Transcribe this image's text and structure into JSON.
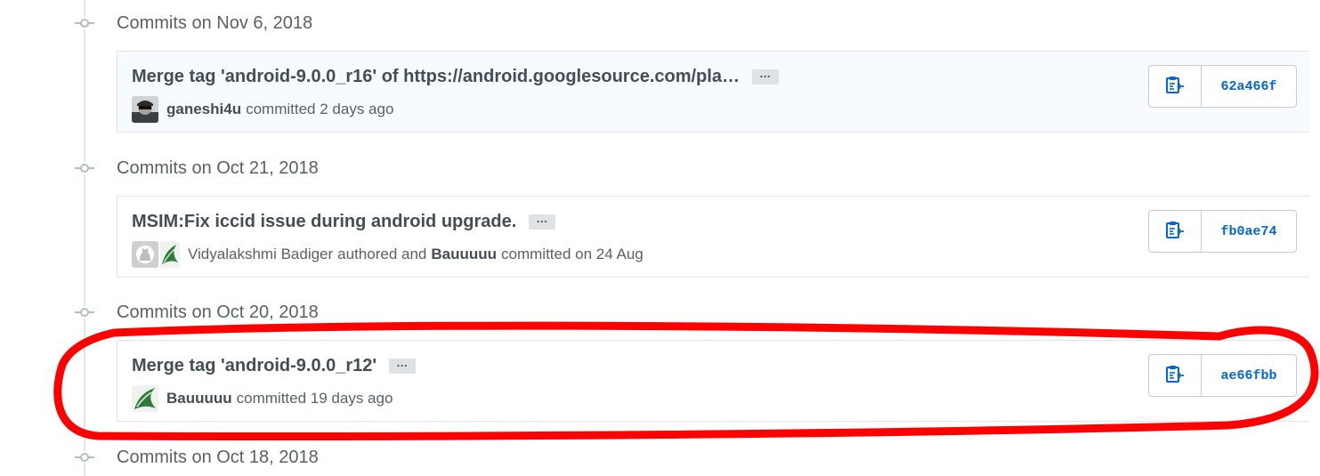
{
  "groups": [
    {
      "date_label": "Commits on Nov 6, 2018",
      "commit": {
        "title": "Merge tag 'android-9.0.0_r16' of https://android.googlesource.com/pla…",
        "ellipsis": "…",
        "committer": "ganeshi4u",
        "action": "committed 2 days ago",
        "sha": "62a466f"
      }
    },
    {
      "date_label": "Commits on Oct 21, 2018",
      "commit": {
        "title": "MSIM:Fix iccid issue during android upgrade.",
        "ellipsis": "…",
        "author": "Vidyalakshmi Badiger",
        "author_action": "authored and",
        "committer": "Bauuuuu",
        "action": "committed on 24 Aug",
        "sha": "fb0ae74"
      }
    },
    {
      "date_label": "Commits on Oct 20, 2018",
      "commit": {
        "title": "Merge tag 'android-9.0.0_r12'",
        "ellipsis": "…",
        "committer": "Bauuuuu",
        "action": "committed 19 days ago",
        "sha": "ae66fbb"
      }
    },
    {
      "date_label": "Commits on Oct 18, 2018"
    }
  ],
  "icons": {
    "copy": "clipboard-copy-icon",
    "timeline_node": "git-commit-icon"
  },
  "colors": {
    "sha_link": "#0366d6",
    "annotation": "#ff0000",
    "highlight_row": "#f7fbff"
  }
}
